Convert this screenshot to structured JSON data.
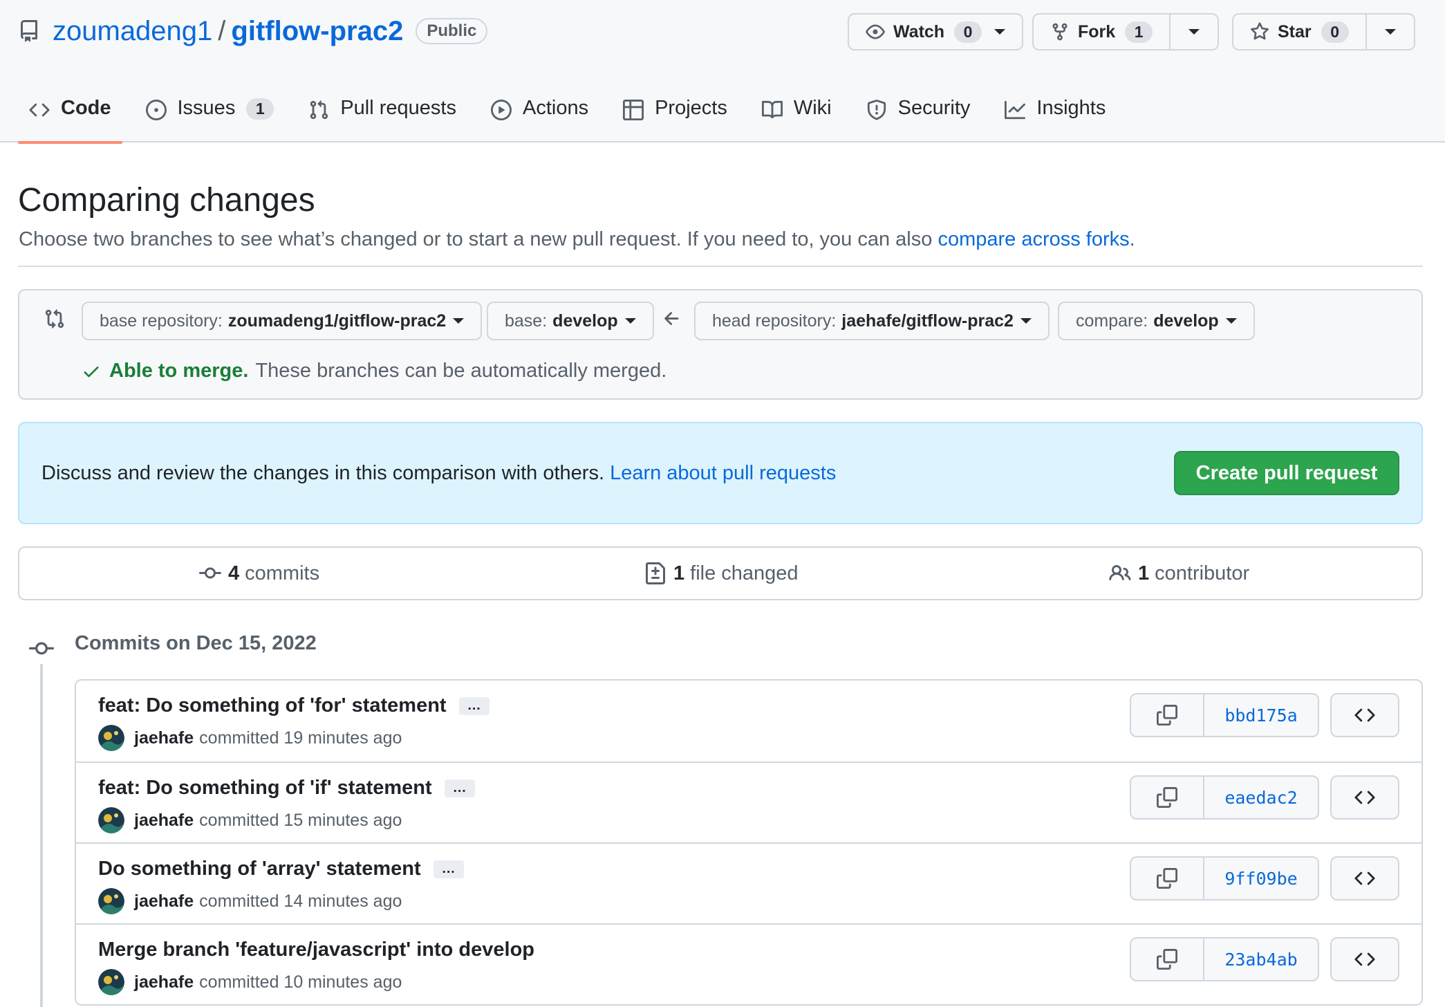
{
  "repo": {
    "owner": "zoumadeng1",
    "separator": "/",
    "name": "gitflow-prac2",
    "visibility": "Public"
  },
  "actions": {
    "watch": {
      "label": "Watch",
      "count": "0"
    },
    "fork": {
      "label": "Fork",
      "count": "1"
    },
    "star": {
      "label": "Star",
      "count": "0"
    }
  },
  "tabs": [
    {
      "label": "Code",
      "icon": "code-icon",
      "active": true
    },
    {
      "label": "Issues",
      "icon": "issue-opened-icon",
      "count": "1"
    },
    {
      "label": "Pull requests",
      "icon": "git-pull-request-icon"
    },
    {
      "label": "Actions",
      "icon": "play-icon"
    },
    {
      "label": "Projects",
      "icon": "table-icon"
    },
    {
      "label": "Wiki",
      "icon": "book-icon"
    },
    {
      "label": "Security",
      "icon": "shield-icon"
    },
    {
      "label": "Insights",
      "icon": "graph-icon"
    }
  ],
  "page": {
    "title": "Comparing changes",
    "description": "Choose two branches to see what’s changed or to start a new pull request. If you need to, you can also ",
    "compare_forks_link": "compare across forks",
    "description_end": "."
  },
  "range": {
    "base_repo_label": "base repository:",
    "base_repo_value": "zoumadeng1/gitflow-prac2",
    "base_label": "base:",
    "base_value": "develop",
    "head_repo_label": "head repository:",
    "head_repo_value": "jaehafe/gitflow-prac2",
    "compare_label": "compare:",
    "compare_value": "develop",
    "merge_ok": "Able to merge.",
    "merge_msg": "These branches can be automatically merged."
  },
  "flash": {
    "message": "Discuss and review the changes in this comparison with others. ",
    "link": "Learn about pull requests",
    "button": "Create pull request"
  },
  "summary": {
    "commits_count": "4",
    "commits_label": "commits",
    "files_count": "1",
    "files_label": "file changed",
    "contributors_count": "1",
    "contributors_label": "contributor"
  },
  "commits_date": "Commits on Dec 15, 2022",
  "commits": [
    {
      "title": "feat: Do something of 'for' statement",
      "author": "jaehafe",
      "time": "committed 19 minutes ago",
      "sha": "bbd175a",
      "has_ellipsis": true
    },
    {
      "title": "feat: Do something of 'if' statement",
      "author": "jaehafe",
      "time": "committed 15 minutes ago",
      "sha": "eaedac2",
      "has_ellipsis": true
    },
    {
      "title": "Do something of 'array' statement",
      "author": "jaehafe",
      "time": "committed 14 minutes ago",
      "sha": "9ff09be",
      "has_ellipsis": true
    },
    {
      "title": "Merge branch 'feature/javascript' into develop",
      "author": "jaehafe",
      "time": "committed 10 minutes ago",
      "sha": "23ab4ab",
      "has_ellipsis": false
    }
  ],
  "colors": {
    "link": "#0969da",
    "success": "#1a7f37",
    "primary_button": "#2da44e",
    "active_tab_underline": "#fd8c73",
    "flash_bg": "#ddf4ff"
  }
}
